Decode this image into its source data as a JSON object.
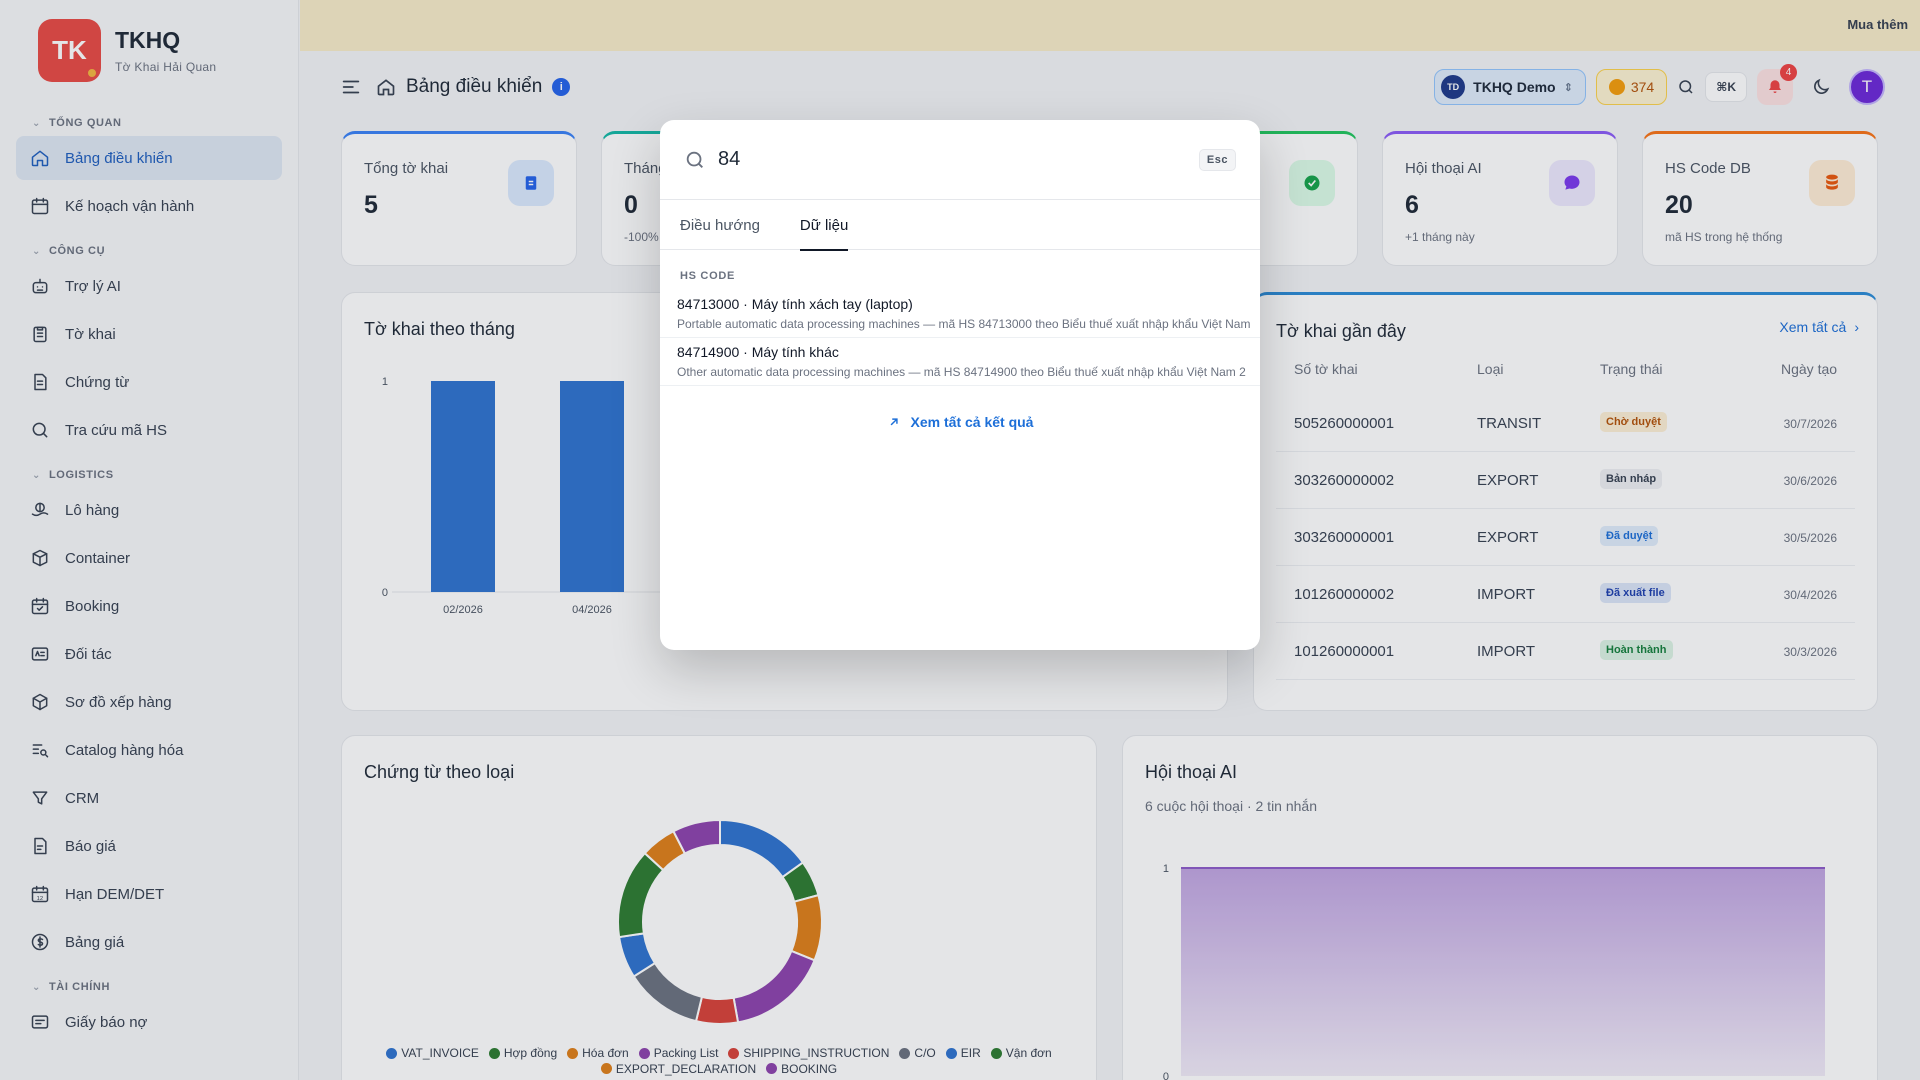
{
  "brand": {
    "logo": "TK",
    "name": "TKHQ",
    "tagline": "Tờ Khai Hải Quan"
  },
  "banner": {
    "more": "Mua thêm"
  },
  "sidebar": {
    "sections": [
      {
        "title": "TỔNG QUAN",
        "items": [
          {
            "label": "Bảng điều khiển",
            "icon": "home-icon",
            "active": true
          },
          {
            "label": "Kế hoạch vận hành",
            "icon": "calendar-icon"
          }
        ]
      },
      {
        "title": "CÔNG CỤ",
        "items": [
          {
            "label": "Trợ lý AI",
            "icon": "robot-icon"
          },
          {
            "label": "Tờ khai",
            "icon": "clipboard-icon"
          },
          {
            "label": "Chứng từ",
            "icon": "file-icon"
          },
          {
            "label": "Tra cứu mã HS",
            "icon": "search-icon"
          }
        ]
      },
      {
        "title": "LOGISTICS",
        "items": [
          {
            "label": "Lô hàng",
            "icon": "ship-icon"
          },
          {
            "label": "Container",
            "icon": "box-icon"
          },
          {
            "label": "Booking",
            "icon": "calendar-check-icon"
          },
          {
            "label": "Đối tác",
            "icon": "contact-card-icon"
          },
          {
            "label": "Sơ đồ xếp hàng",
            "icon": "cube-icon"
          },
          {
            "label": "Catalog hàng hóa",
            "icon": "list-search-icon"
          },
          {
            "label": "CRM",
            "icon": "funnel-icon"
          },
          {
            "label": "Báo giá",
            "icon": "document-icon"
          },
          {
            "label": "Hạn DEM/DET",
            "icon": "calendar-12-icon"
          },
          {
            "label": "Bảng giá",
            "icon": "dollar-icon"
          }
        ]
      },
      {
        "title": "TÀI CHÍNH",
        "items": [
          {
            "label": "Giấy báo nợ",
            "icon": "receipt-icon"
          }
        ]
      }
    ]
  },
  "header": {
    "title": "Bảng điều khiển",
    "info": "i",
    "org": {
      "badge": "TD",
      "name": "TKHQ Demo"
    },
    "coins": "374",
    "shortcut": "⌘K",
    "notifications": "4",
    "avatar": "T"
  },
  "stats": [
    {
      "label": "Tổng tờ khai",
      "value": "5",
      "sub": "",
      "color": "#3b82f6"
    },
    {
      "label": "Tháng",
      "value": "0",
      "sub": "-100%",
      "color": "#14b8a6"
    },
    {
      "label": "",
      "value": "",
      "sub": "",
      "color": "#22c55e"
    },
    {
      "label": "Hội thoại AI",
      "value": "6",
      "sub": "+1 tháng này",
      "color": "#8b5cf6"
    },
    {
      "label": "HS Code DB",
      "value": "20",
      "sub": "mã HS trong hệ thống",
      "color": "#f97316"
    }
  ],
  "monthly_panel": {
    "title": "Tờ khai theo tháng"
  },
  "recent_panel": {
    "title": "Tờ khai gần đây",
    "view_all": "Xem tất cả",
    "columns": [
      "Số tờ khai",
      "Loại",
      "Trạng thái",
      "Ngày tạo"
    ],
    "rows": [
      {
        "no": "505260000001",
        "type": "TRANSIT",
        "status": "Chờ duyệt",
        "status_color": "#b45309",
        "status_bg": "#fdf0d5",
        "date": "30/7/2026"
      },
      {
        "no": "303260000002",
        "type": "EXPORT",
        "status": "Bản nháp",
        "status_color": "#374151",
        "status_bg": "#eef0f3",
        "date": "30/6/2026"
      },
      {
        "no": "303260000001",
        "type": "EXPORT",
        "status": "Đã duyệt",
        "status_color": "#1d6fd8",
        "status_bg": "#e0ecfb",
        "date": "30/5/2026"
      },
      {
        "no": "101260000002",
        "type": "IMPORT",
        "status": "Đã xuất file",
        "status_color": "#1e40af",
        "status_bg": "#dbe5f8",
        "date": "30/4/2026"
      },
      {
        "no": "101260000001",
        "type": "IMPORT",
        "status": "Hoàn thành",
        "status_color": "#15803d",
        "status_bg": "#dcf3e4",
        "date": "30/3/2026"
      }
    ]
  },
  "docs_panel": {
    "title": "Chứng từ theo loại"
  },
  "ai_panel": {
    "title": "Hội thoại AI",
    "subtitle": "6 cuộc hội thoại · 2 tin nhắn"
  },
  "chart_data": [
    {
      "type": "bar",
      "title": "Tờ khai theo tháng",
      "categories": [
        "02/2026",
        "04/2026"
      ],
      "values": [
        1,
        1
      ],
      "ylim": [
        0,
        1
      ],
      "yticks": [
        "0",
        "1"
      ],
      "color": "#2f74d0"
    },
    {
      "type": "pie",
      "title": "Chứng từ theo loại",
      "donut": true,
      "labels": [
        "VAT_INVOICE",
        "Hợp đồng",
        "Hóa đơn",
        "Packing List",
        "SHIPPING_INSTRUCTION",
        "C/O",
        "EIR",
        "Vận đơn",
        "EXPORT_DECLARATION",
        "BOOKING"
      ],
      "colors": [
        "#2f74d0",
        "#2e7d32",
        "#e0801a",
        "#8e44ad",
        "#d9433a",
        "#6b7280",
        "#2f74d0",
        "#2e7d32",
        "#e0801a",
        "#8e44ad"
      ],
      "values": [
        16,
        6,
        11,
        17,
        7,
        13,
        7,
        15,
        6,
        8
      ]
    },
    {
      "type": "area",
      "title": "Hội thoại AI",
      "ylim": [
        0,
        1
      ],
      "yticks": [
        "0",
        "1"
      ],
      "values": [
        1,
        1
      ],
      "color": "#8e5cc9"
    }
  ],
  "search_modal": {
    "query": "84",
    "esc": "Esc",
    "tabs": [
      "Điều hướng",
      "Dữ liệu"
    ],
    "active_tab": 1,
    "group_title": "HS CODE",
    "results": [
      {
        "title": "84713000 · Máy tính xách tay (laptop)",
        "desc": "Portable automatic data processing machines — mã HS 84713000 theo Biểu thuế xuất nhập khẩu Việt Nam"
      },
      {
        "title": "84714900 · Máy tính khác",
        "desc": "Other automatic data processing machines — mã HS 84714900 theo Biểu thuế xuất nhập khẩu Việt Nam 2"
      }
    ],
    "view_all": "Xem tất cả kết quả"
  }
}
